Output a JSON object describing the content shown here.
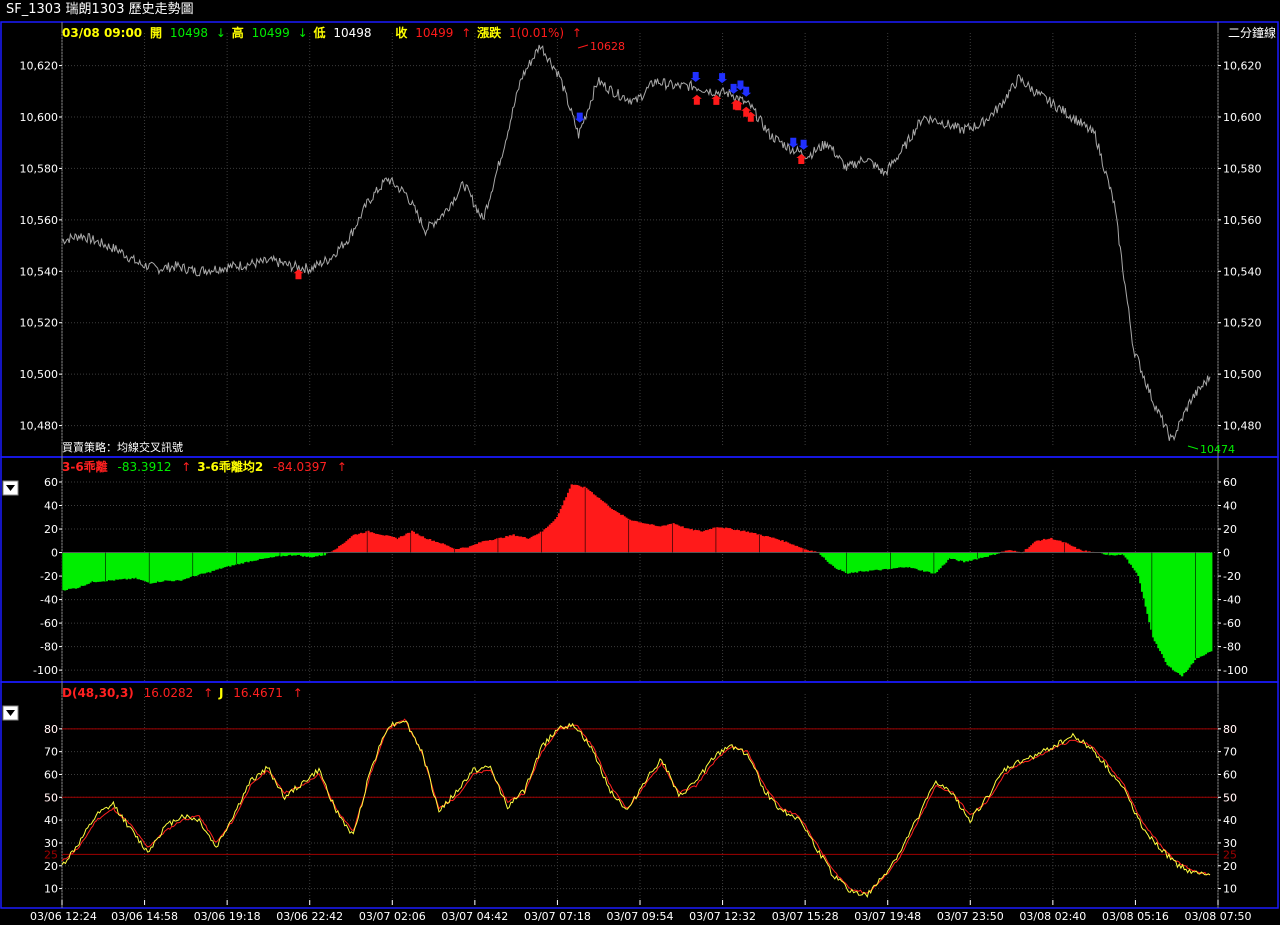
{
  "window": {
    "title": "SF_1303 瑞朗1303  歷史走勢圖"
  },
  "colors": {
    "bg": "#000000",
    "frame": "#1a1aff",
    "grid": "#3c3c3c",
    "price": "#a8a8a8",
    "up": "#ff1a1a",
    "down": "#00ee00",
    "d": "#ff2020",
    "j": "#ffff40",
    "yellow": "#ffff00"
  },
  "header": {
    "datetime": "03/08 09:00",
    "open_lbl": "開",
    "open": "10498",
    "open_arrow": "↓",
    "high_lbl": "高",
    "high": "10499",
    "high_arrow": "↓",
    "low_lbl": "低",
    "low": "10498",
    "close_lbl": "收",
    "close": "10499",
    "close_arrow": "↑",
    "chg_lbl": "漲跌",
    "chg": "1(0.01%)",
    "chg_arrow": "↑",
    "period": "二分鐘線"
  },
  "strategy": "買賣策略：均線交叉訊號",
  "price_ann": {
    "high": "10628",
    "low": "10474"
  },
  "ind1": {
    "name": "3-6乖離",
    "value": "-83.3912",
    "arrow": "↑",
    "name2": "3-6乖離均2",
    "value2": "-84.0397",
    "arrow2": "↑"
  },
  "ind2": {
    "name": "D(48,30,3)",
    "value": "16.0282",
    "arrow": "↑",
    "name2": "J",
    "value2": "16.4671",
    "arrow2": "↑"
  },
  "collapse_icon": "triangle-down-icon",
  "chart_data": [
    {
      "type": "line",
      "series": [
        {
          "name": "",
          "values": [
            10552,
            10554,
            10551,
            10548,
            10543,
            10541,
            10542,
            10540,
            10541,
            10542,
            10543,
            10544,
            10542,
            10541,
            10545,
            10553,
            10567,
            10576,
            10570,
            10556,
            10563,
            10574,
            10560,
            10586,
            10615,
            10628,
            10616,
            10593,
            10614,
            10609,
            10606,
            10614,
            10612,
            10612,
            10610,
            10609,
            10604,
            10593,
            10588,
            10585,
            10590,
            10580,
            10584,
            10578,
            10588,
            10600,
            10598,
            10595,
            10597,
            10604,
            10615,
            10609,
            10604,
            10599,
            10593,
            10566,
            10510,
            10490,
            10474,
            10490,
            10499
          ]
        }
      ],
      "x_ticks": [
        "03/06 12:24",
        "03/06 14:58",
        "03/06 19:18",
        "03/06 22:42",
        "03/07 02:06",
        "03/07 04:42",
        "03/07 07:18",
        "03/07 09:54",
        "03/07 12:32",
        "03/07 15:28",
        "03/07 19:48",
        "03/07 23:50",
        "03/08 02:40",
        "03/08 05:16",
        "03/08 07:50"
      ],
      "ylim": [
        10474,
        10628
      ],
      "y_ticks": [
        "10,480",
        "10,500",
        "10,520",
        "10,540",
        "10,560",
        "10,580",
        "10,600",
        "10,620"
      ],
      "buy_signals": [
        0.206,
        0.553,
        0.57,
        0.587,
        0.589,
        0.596,
        0.6,
        0.644
      ],
      "sell_signals": [
        0.451,
        0.552,
        0.575,
        0.585,
        0.591,
        0.596,
        0.637,
        0.646
      ],
      "grid": true
    },
    {
      "type": "area",
      "series": [
        {
          "name": "3-6乖離",
          "values": [
            -32,
            -30,
            -25,
            -24,
            -23,
            -22,
            -26,
            -24,
            -24,
            -20,
            -17,
            -13,
            -10,
            -7,
            -5,
            -3,
            -2,
            -4,
            -2,
            5,
            15,
            18,
            15,
            12,
            18,
            12,
            8,
            3,
            5,
            10,
            12,
            15,
            12,
            18,
            30,
            58,
            55,
            45,
            35,
            28,
            25,
            22,
            25,
            20,
            18,
            22,
            20,
            18,
            15,
            12,
            8,
            3,
            0,
            -12,
            -18,
            -16,
            -15,
            -14,
            -12,
            -15,
            -18,
            -5,
            -8,
            -5,
            -2,
            2,
            0,
            10,
            12,
            8,
            2,
            0,
            -2,
            -2,
            -20,
            -72,
            -96,
            -105,
            -90,
            -84
          ]
        }
      ],
      "ylim": [
        -105,
        60
      ],
      "y_ticks": [
        "-100",
        "-80",
        "-60",
        "-40",
        "-20",
        "0",
        "20",
        "40",
        "60"
      ],
      "grid": true
    },
    {
      "type": "line",
      "series": [
        {
          "name": "D(48,30,3)",
          "values": [
            22,
            28,
            40,
            45,
            38,
            28,
            35,
            40,
            42,
            30,
            40,
            55,
            62,
            52,
            55,
            60,
            45,
            35,
            60,
            80,
            84,
            70,
            45,
            50,
            60,
            62,
            48,
            52,
            70,
            80,
            82,
            72,
            55,
            45,
            55,
            65,
            52,
            55,
            65,
            72,
            70,
            55,
            45,
            42,
            30,
            18,
            10,
            8,
            15,
            25,
            40,
            55,
            52,
            42,
            48,
            60,
            65,
            68,
            72,
            75,
            73,
            65,
            55,
            40,
            30,
            22,
            18,
            16
          ]
        },
        {
          "name": "J",
          "values": [
            20,
            30,
            42,
            47,
            36,
            26,
            37,
            42,
            40,
            28,
            42,
            57,
            63,
            50,
            56,
            62,
            44,
            33,
            62,
            81,
            84,
            70,
            44,
            52,
            62,
            63,
            46,
            53,
            72,
            81,
            81,
            70,
            53,
            44,
            57,
            67,
            50,
            57,
            67,
            73,
            69,
            53,
            44,
            41,
            28,
            16,
            9,
            7,
            16,
            27,
            42,
            57,
            51,
            40,
            50,
            62,
            66,
            69,
            73,
            77,
            72,
            63,
            53,
            38,
            28,
            21,
            17,
            16
          ]
        }
      ],
      "ylim": [
        5,
        90
      ],
      "y_ticks": [
        "10",
        "20",
        "30",
        "40",
        "50",
        "60",
        "70",
        "80"
      ],
      "levels": [
        "25",
        "50",
        "80"
      ],
      "grid": true
    }
  ]
}
